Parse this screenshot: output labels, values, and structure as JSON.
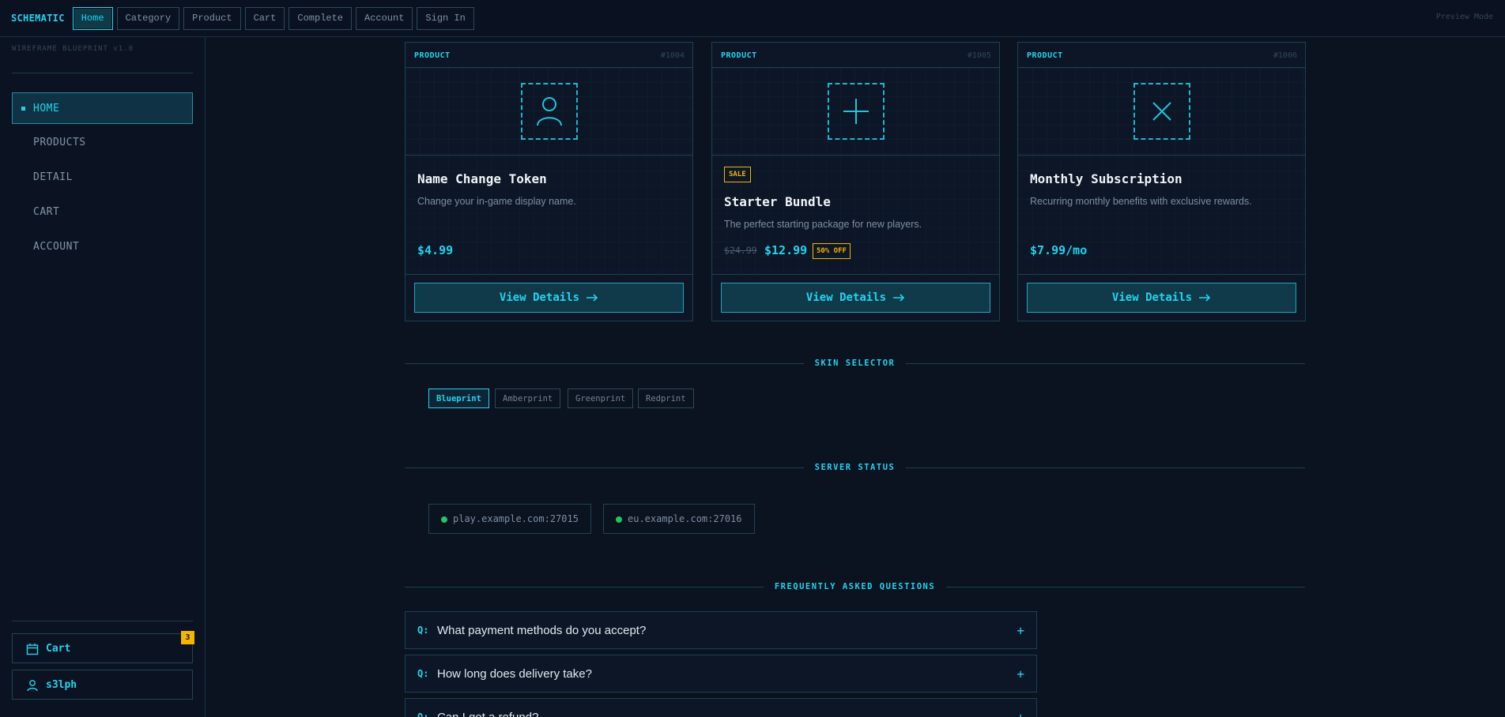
{
  "header": {
    "brand": "SCHEMATIC",
    "nav": [
      "Home",
      "Category",
      "Product",
      "Cart",
      "Complete",
      "Account",
      "Sign In"
    ],
    "active_nav": "Home",
    "preview": "Preview Mode"
  },
  "sidebar": {
    "version": "WIREFRAME BLUEPRINT v1.0",
    "items": [
      "HOME",
      "PRODUCTS",
      "DETAIL",
      "CART",
      "ACCOUNT"
    ],
    "cart_label": "Cart",
    "cart_count": "3",
    "user": "s3lph"
  },
  "products": [
    {
      "type": "PRODUCT",
      "id": "#1004",
      "icon": "user-icon",
      "title": "Name Change Token",
      "desc": "Change your in-game display name.",
      "price": "$4.99",
      "button": "View Details"
    },
    {
      "type": "PRODUCT",
      "id": "#1005",
      "icon": "plus-icon",
      "sale": "SALE",
      "title": "Starter Bundle",
      "desc": "The perfect starting package for new players.",
      "old_price": "$24.99",
      "price": "$12.99",
      "off": "50% OFF",
      "button": "View Details"
    },
    {
      "type": "PRODUCT",
      "id": "#1006",
      "icon": "close-icon",
      "title": "Monthly Subscription",
      "desc": "Recurring monthly benefits with exclusive rewards.",
      "price": "$7.99/mo",
      "button": "View Details"
    }
  ],
  "skin_selector": {
    "title": "SKIN SELECTOR",
    "options": [
      "Blueprint",
      "Amberprint",
      "Greenprint",
      "Redprint"
    ],
    "selected": "Blueprint"
  },
  "server_status": {
    "title": "SERVER STATUS",
    "servers": [
      {
        "host": "play.example.com:27015",
        "status_color": "#22c55e"
      },
      {
        "host": "eu.example.com:27016",
        "status_color": "#22c55e"
      }
    ]
  },
  "faq": {
    "title": "FREQUENTLY ASKED QUESTIONS",
    "q_prefix": "Q:",
    "questions": [
      "What payment methods do you accept?",
      "How long does delivery take?",
      "Can I get a refund?"
    ]
  },
  "colors": {
    "accent": "#22d3ee",
    "warning": "#f5b400",
    "online": "#22c55e",
    "background": "#0b1220"
  }
}
